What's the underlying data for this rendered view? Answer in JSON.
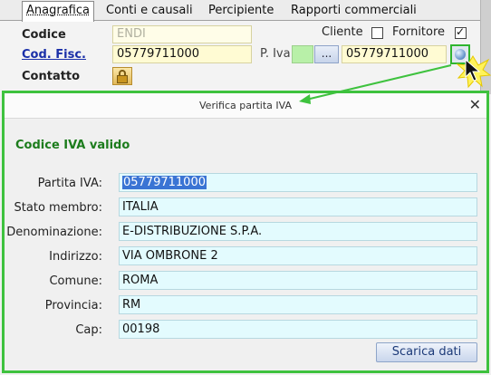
{
  "tabs": [
    "Anagrafica",
    "Conti e causali",
    "Percipiente",
    "Rapporti commerciali"
  ],
  "form": {
    "codice_label": "Codice",
    "codice_value": "ENDI",
    "cliente_label": "Cliente",
    "cliente_checked": false,
    "fornitore_label": "Fornitore",
    "fornitore_checked": true,
    "codfisc_label": "Cod. Fisc.",
    "codfisc_value": "05779711000",
    "piva_label": "P. Iva",
    "piva_dots": "...",
    "piva_value": "05779711000",
    "contatto_label": "Contatto"
  },
  "dialog": {
    "title": "Verifica partita IVA",
    "close": "✕",
    "valid_message": "Codice IVA valido",
    "fields": [
      {
        "label": "Partita IVA:",
        "value": "05779711000"
      },
      {
        "label": "Stato membro:",
        "value": "ITALIA"
      },
      {
        "label": "Denominazione:",
        "value": "E-DISTRIBUZIONE S.P.A."
      },
      {
        "label": "Indirizzo:",
        "value": "VIA OMBRONE 2"
      },
      {
        "label": "Comune:",
        "value": "ROMA"
      },
      {
        "label": "Provincia:",
        "value": "RM"
      },
      {
        "label": "Cap:",
        "value": "00198"
      }
    ],
    "download_button": "Scarica dati"
  },
  "colors": {
    "highlight": "#3ec23e",
    "link": "#1a2fa8",
    "valid": "#1c7c1c"
  }
}
